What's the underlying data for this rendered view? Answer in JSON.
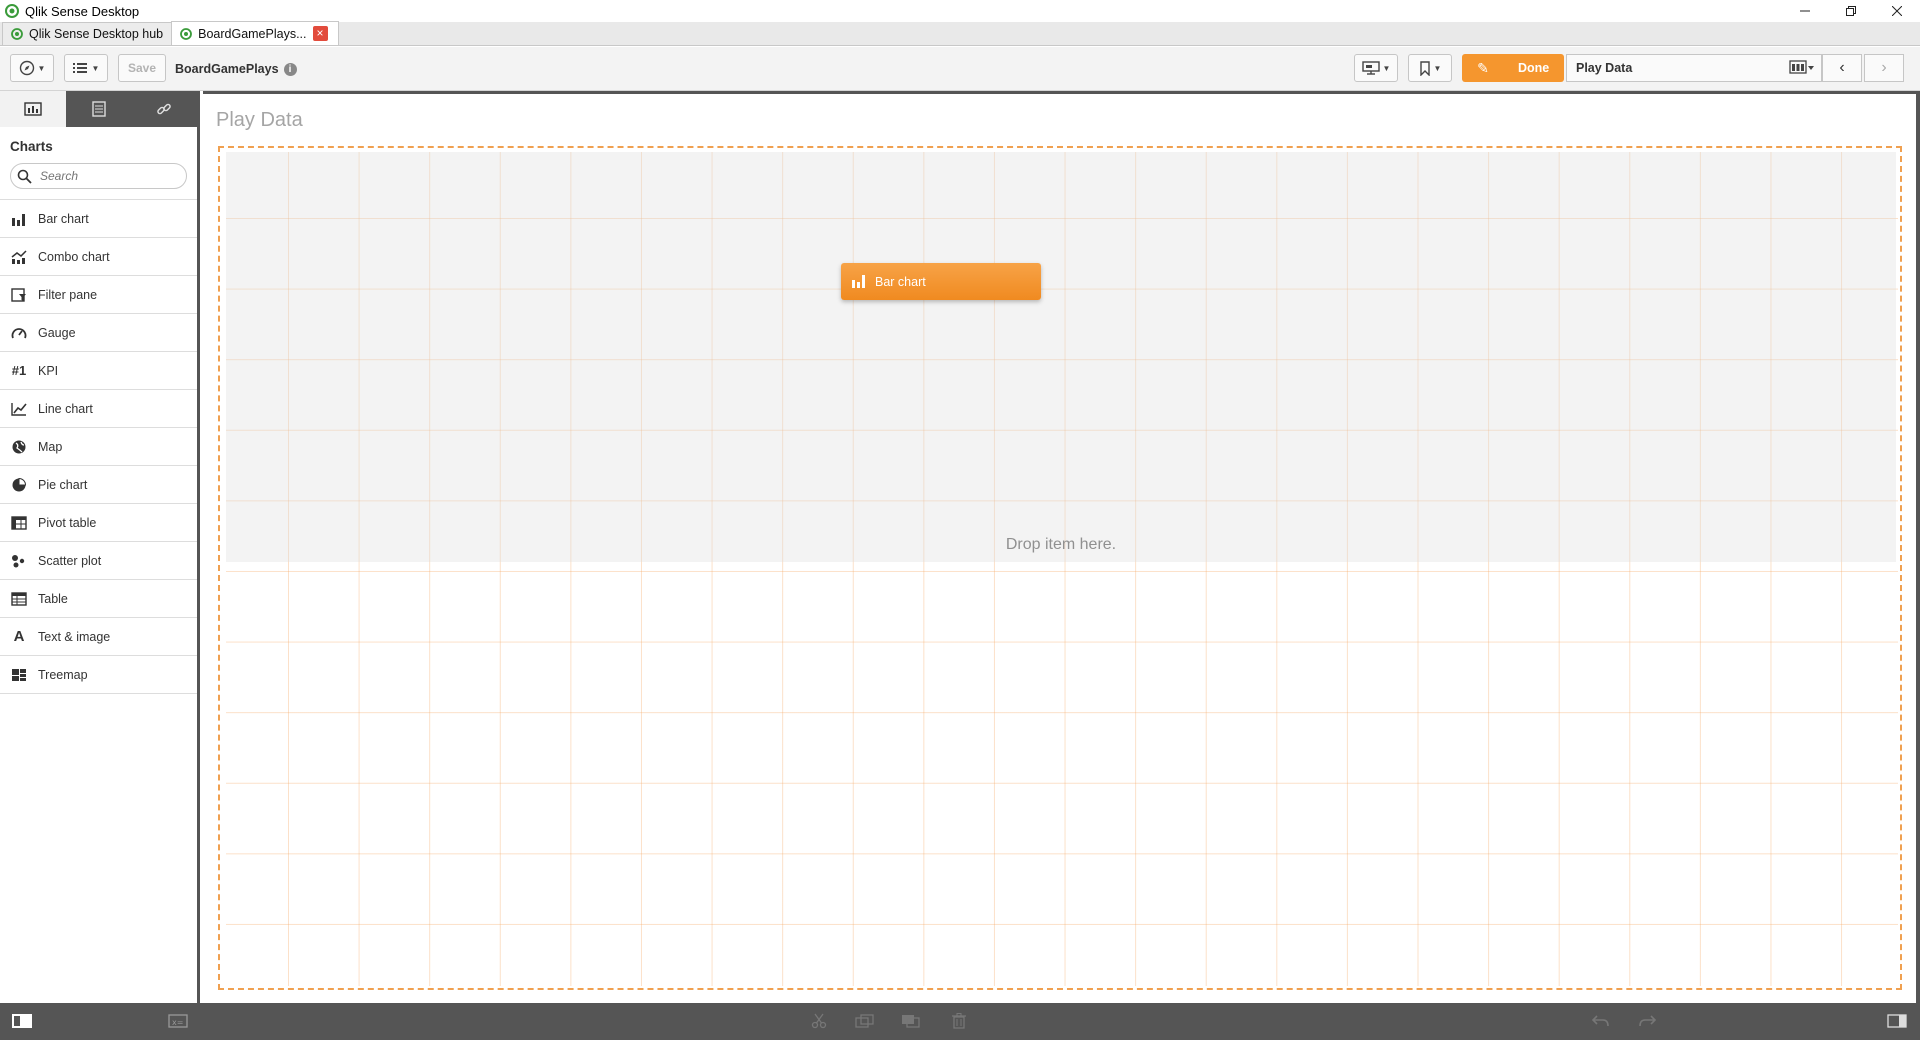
{
  "window": {
    "title": "Qlik Sense Desktop",
    "controls": [
      "minimize",
      "restore",
      "close"
    ]
  },
  "tabs": [
    {
      "label": "Qlik Sense Desktop hub",
      "active": false
    },
    {
      "label": "BoardGamePlays...",
      "active": true
    }
  ],
  "toolbar": {
    "save_label": "Save",
    "app_name": "BoardGamePlays",
    "info_glyph": "i",
    "done_label": "Done",
    "sheet_title": "Play Data"
  },
  "left_panel": {
    "heading": "Charts",
    "search_placeholder": "Search",
    "items": [
      {
        "label": "Bar chart",
        "icon": "bar-chart-icon"
      },
      {
        "label": "Combo chart",
        "icon": "combo-chart-icon"
      },
      {
        "label": "Filter pane",
        "icon": "filter-pane-icon"
      },
      {
        "label": "Gauge",
        "icon": "gauge-icon"
      },
      {
        "label": "KPI",
        "icon": "kpi-icon",
        "glyph": "#1"
      },
      {
        "label": "Line chart",
        "icon": "line-chart-icon"
      },
      {
        "label": "Map",
        "icon": "map-icon"
      },
      {
        "label": "Pie chart",
        "icon": "pie-chart-icon"
      },
      {
        "label": "Pivot table",
        "icon": "pivot-table-icon"
      },
      {
        "label": "Scatter plot",
        "icon": "scatter-plot-icon"
      },
      {
        "label": "Table",
        "icon": "table-icon"
      },
      {
        "label": "Text & image",
        "icon": "text-image-icon",
        "glyph": "A"
      },
      {
        "label": "Treemap",
        "icon": "treemap-icon"
      }
    ]
  },
  "canvas": {
    "title": "Play Data",
    "drop_text": "Drop item here.",
    "dragged_item": "Bar chart"
  },
  "colors": {
    "accent": "#f5962e",
    "panel_dark": "#555555",
    "grid_line": "#f5a864"
  }
}
